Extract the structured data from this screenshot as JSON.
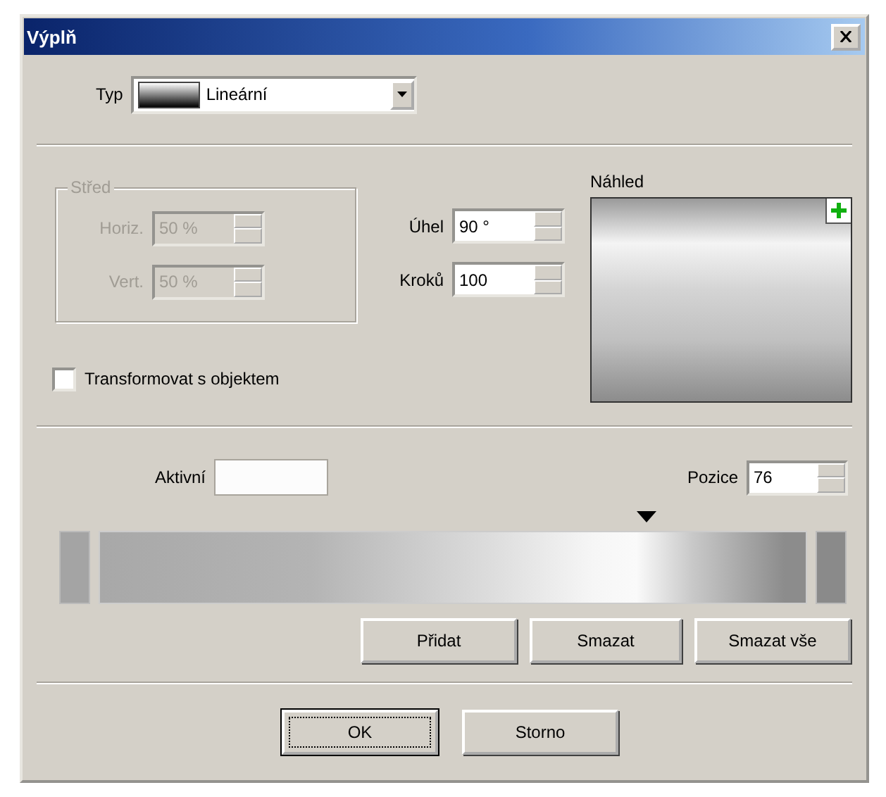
{
  "window": {
    "title": "Výplň"
  },
  "type_field": {
    "label": "Typ",
    "value": "Lineární"
  },
  "center_group": {
    "title": "Střed",
    "disabled": true,
    "fields": [
      {
        "label": "Horiz.",
        "value": "50 %"
      },
      {
        "label": "Vert.",
        "value": "50 %"
      }
    ]
  },
  "angle": {
    "label": "Úhel",
    "value": "90 °"
  },
  "steps": {
    "label": "Kroků",
    "value": "100"
  },
  "preview": {
    "label": "Náhled"
  },
  "transform_checkbox": {
    "label": "Transformovat s objektem",
    "checked": false
  },
  "active": {
    "label": "Aktivní"
  },
  "position": {
    "label": "Pozice",
    "value": "76"
  },
  "gradient_marker": {
    "level": 0.76
  },
  "stop_buttons": [
    "Přidat",
    "Smazat",
    "Smazat vše"
  ],
  "buttons": [
    {
      "label": "OK",
      "default": true
    },
    {
      "label": "Storno",
      "default": false
    }
  ]
}
